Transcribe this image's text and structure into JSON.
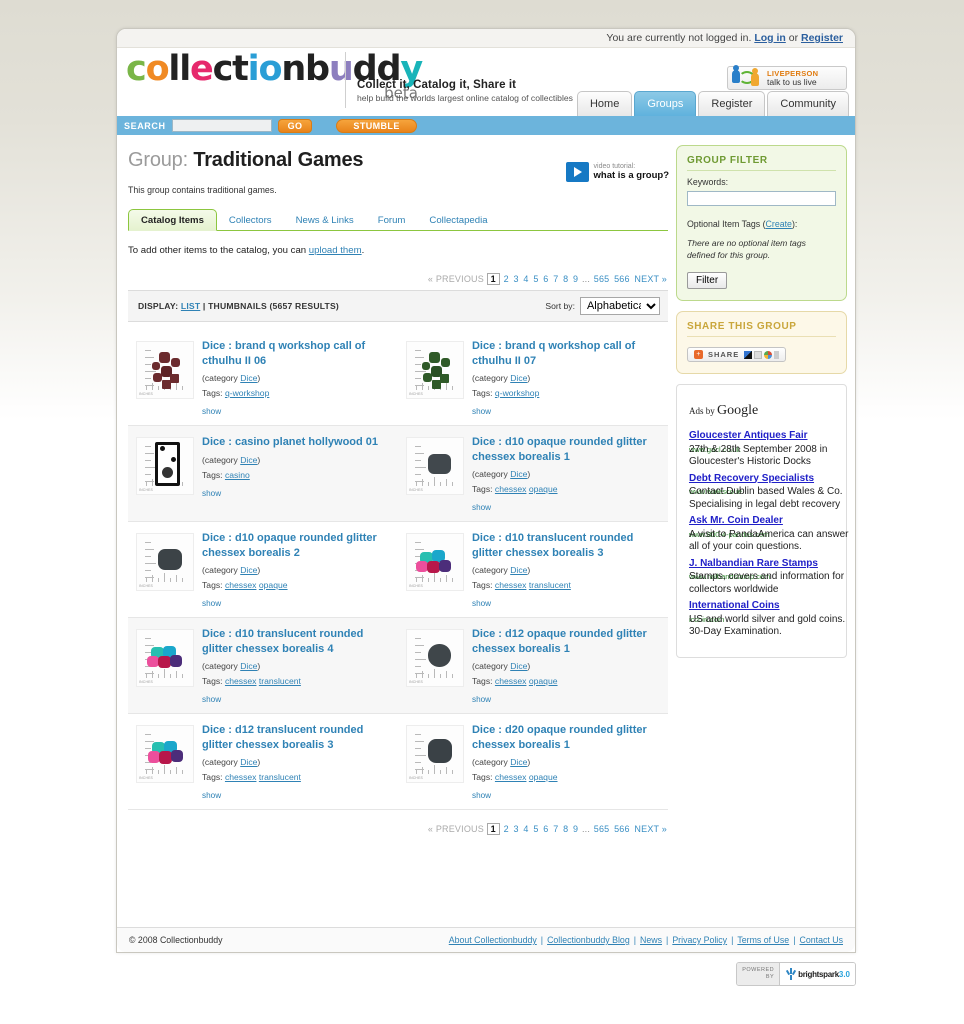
{
  "topbar": {
    "text": "You are currently not logged in. ",
    "login": "Log in",
    "or": " or ",
    "register": "Register"
  },
  "brand": {
    "logo_parts": [
      "c",
      "o",
      "ll",
      "e",
      "ction",
      "b",
      "u",
      "dd",
      "y"
    ],
    "beta": "beta",
    "tagline_main": "Collect it, Catalog it, Share it",
    "tagline_sub": "help build the worlds largest online catalog of collectibles",
    "liveperson_top": "LIVEPERSON",
    "liveperson_bottom": "talk to us live"
  },
  "nav": {
    "tabs": [
      {
        "label": "Home",
        "active": false
      },
      {
        "label": "Groups",
        "active": true
      },
      {
        "label": "Register",
        "active": false
      },
      {
        "label": "Community",
        "active": false
      }
    ]
  },
  "search": {
    "label": "SEARCH",
    "value": "",
    "placeholder": "",
    "go": "GO",
    "stumble": "STUMBLE"
  },
  "group": {
    "title_prefix": "Group:",
    "title": "Traditional Games",
    "description": "This group contains traditional games.",
    "video_small": "video tutorial:",
    "video_big": "what is a group?"
  },
  "subtabs": [
    {
      "label": "Catalog Items",
      "active": true
    },
    {
      "label": "Collectors",
      "active": false
    },
    {
      "label": "News & Links",
      "active": false
    },
    {
      "label": "Forum",
      "active": false
    },
    {
      "label": "Collectapedia",
      "active": false
    }
  ],
  "addnote": {
    "before": "To add other items to the catalog, you can ",
    "link": "upload them",
    "after": "."
  },
  "pager": {
    "previous": "« PREVIOUS",
    "pages": [
      "1",
      "2",
      "3",
      "4",
      "5",
      "6",
      "7",
      "8",
      "9",
      "...",
      "565",
      "566"
    ],
    "current": "1",
    "next": "NEXT »"
  },
  "display": {
    "label": "DISPLAY:",
    "list": "LIST",
    "divider": "|",
    "thumbnails": "THUMBNAILS (5657 RESULTS)",
    "sort_label": "Sort by:",
    "sort_value": "Alphabetical",
    "sort_options": [
      "Alphabetical"
    ]
  },
  "items": [
    {
      "title": "Dice : brand q workshop call of cthulhu II 06",
      "category_prefix": "(category ",
      "category": "Dice",
      "category_suffix": ")",
      "tags_label": "Tags:",
      "tags": [
        "q-workshop"
      ],
      "show": "show",
      "thumb": "dice-maroon-set"
    },
    {
      "title": "Dice : brand q workshop call of cthulhu II 07",
      "category_prefix": "(category ",
      "category": "Dice",
      "category_suffix": ")",
      "tags_label": "Tags:",
      "tags": [
        "q-workshop"
      ],
      "show": "show",
      "thumb": "dice-green-set"
    },
    {
      "title": "Dice : casino planet hollywood 01",
      "category_prefix": "(category ",
      "category": "Dice",
      "category_suffix": ")",
      "tags_label": "Tags:",
      "tags": [
        "casino"
      ],
      "show": "show",
      "thumb": "dice-casino-white"
    },
    {
      "title": "Dice : d10 opaque rounded glitter chessex borealis 1",
      "category_prefix": "(category ",
      "category": "Dice",
      "category_suffix": ")",
      "tags_label": "Tags:",
      "tags": [
        "chessex",
        "opaque"
      ],
      "show": "show",
      "thumb": "dice-d10-dark-single"
    },
    {
      "title": "Dice : d10 opaque rounded glitter chessex borealis 2",
      "category_prefix": "(category ",
      "category": "Dice",
      "category_suffix": ")",
      "tags_label": "Tags:",
      "tags": [
        "chessex",
        "opaque"
      ],
      "show": "show",
      "thumb": "dice-d10-dark-single"
    },
    {
      "title": "Dice : d10 translucent rounded glitter chessex borealis 3",
      "category_prefix": "(category ",
      "category": "Dice",
      "category_suffix": ")",
      "tags_label": "Tags:",
      "tags": [
        "chessex",
        "translucent"
      ],
      "show": "show",
      "thumb": "dice-colorful-cluster"
    },
    {
      "title": "Dice : d10 translucent rounded glitter chessex borealis 4",
      "category_prefix": "(category ",
      "category": "Dice",
      "category_suffix": ")",
      "tags_label": "Tags:",
      "tags": [
        "chessex",
        "translucent"
      ],
      "show": "show",
      "thumb": "dice-colorful-cluster"
    },
    {
      "title": "Dice : d12 opaque rounded glitter chessex borealis 1",
      "category_prefix": "(category ",
      "category": "Dice",
      "category_suffix": ")",
      "tags_label": "Tags:",
      "tags": [
        "chessex",
        "opaque"
      ],
      "show": "show",
      "thumb": "dice-d12-dark-single"
    },
    {
      "title": "Dice : d12 translucent rounded glitter chessex borealis 3",
      "category_prefix": "(category ",
      "category": "Dice",
      "category_suffix": ")",
      "tags_label": "Tags:",
      "tags": [
        "chessex",
        "translucent"
      ],
      "show": "show",
      "thumb": "dice-colorful-cluster"
    },
    {
      "title": "Dice : d20 opaque rounded glitter chessex borealis 1",
      "category_prefix": "(category ",
      "category": "Dice",
      "category_suffix": ")",
      "tags_label": "Tags:",
      "tags": [
        "chessex",
        "opaque"
      ],
      "show": "show",
      "thumb": "dice-d20-dark-single"
    }
  ],
  "filter_panel": {
    "title": "GROUP FILTER",
    "keywords_label": "Keywords:",
    "keywords_value": "",
    "optional_before": "Optional Item Tags (",
    "optional_link": "Create",
    "optional_after": "):",
    "empty_note": "There are no optional item tags defined for this group.",
    "button": "Filter"
  },
  "share_panel": {
    "title": "SHARE THIS GROUP",
    "button": "SHARE"
  },
  "ads": {
    "header_prefix": "Ads by ",
    "header_brand": "Google",
    "entries": [
      {
        "title": "Gloucester Antiques Fair",
        "desc": "27th & 28th September 2008 in Gloucester's Historic Docks",
        "url": "www.gacl.co.uk"
      },
      {
        "title": "Debt Recovery Specialists",
        "desc": "Contact Dublin based Wales & Co. Specialising in legal debt recovery",
        "url": "www.walesco.ie"
      },
      {
        "title": "Ask Mr. Coin Dealer",
        "desc": "A visit to PandaAmerica can answer all of your coin questions.",
        "url": "www.800-4-pandas.com"
      },
      {
        "title": "J. Nalbandian Rare Stamps",
        "desc": "Stamps, covers and information for collectors worldwide",
        "url": "www.nalbandstamp.com"
      },
      {
        "title": "International Coins",
        "desc": "US and world silver and gold coins. 30-Day Examination.",
        "url": "iccoin.com"
      }
    ]
  },
  "footer": {
    "copyright": "© 2008 Collectionbuddy",
    "links": [
      "About Collectionbuddy",
      "Collectionbuddy Blog",
      "News",
      "Privacy Policy",
      "Terms of Use",
      "Contact Us"
    ]
  },
  "powered": {
    "line1": "POWERED",
    "line2": "BY",
    "brand": "brightspark",
    "version": "3.0"
  },
  "colors": {
    "accent_blue": "#2f82b5",
    "searchbar_blue": "#6cb4dc",
    "orange_button": "#e8831a",
    "filter_green": "#8cc63f",
    "ad_link_blue": "#2020c8"
  }
}
